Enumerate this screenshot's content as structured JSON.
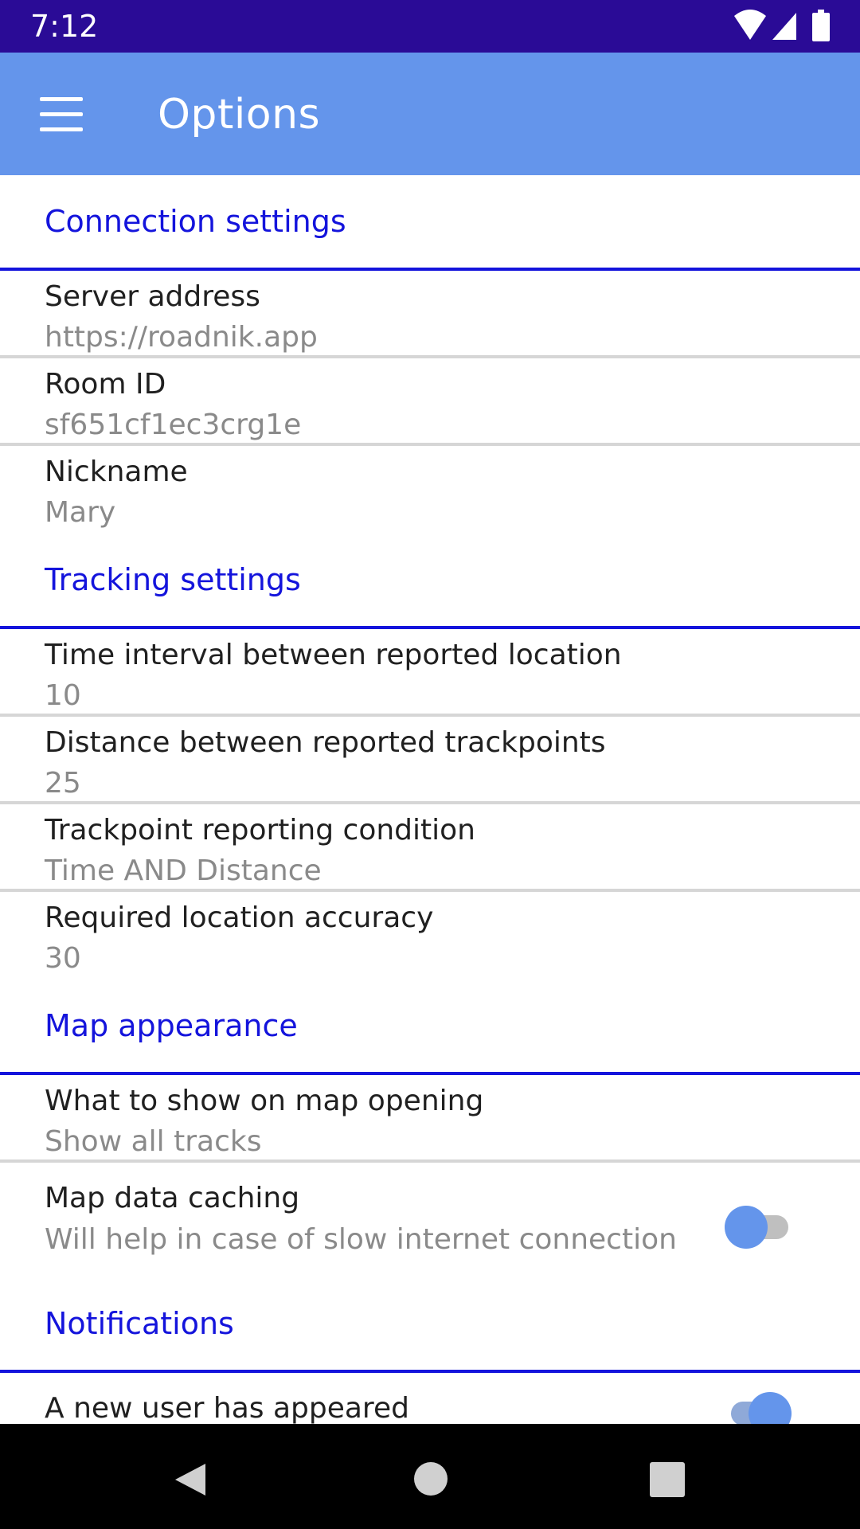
{
  "status_bar": {
    "time": "7:12",
    "icons": [
      "wifi-icon",
      "signal-icon",
      "battery-icon"
    ]
  },
  "app_bar": {
    "title": "Options",
    "menu_icon": "hamburger-menu-icon"
  },
  "sections": {
    "connection": {
      "header": "Connection settings",
      "server_address": {
        "title": "Server address",
        "summary": "https://roadnik.app"
      },
      "room_id": {
        "title": "Room ID",
        "summary": "sf651cf1ec3crg1e"
      },
      "nickname": {
        "title": "Nickname",
        "summary": "Mary"
      }
    },
    "tracking": {
      "header": "Tracking settings",
      "time_interval": {
        "title": "Time interval between reported location",
        "summary": "10"
      },
      "distance": {
        "title": "Distance between reported trackpoints",
        "summary": "25"
      },
      "condition": {
        "title": "Trackpoint reporting condition",
        "summary": "Time AND Distance"
      },
      "accuracy": {
        "title": "Required location accuracy",
        "summary": "30"
      }
    },
    "map": {
      "header": "Map appearance",
      "map_opening": {
        "title": "What to show on map opening",
        "summary": "Show all tracks"
      },
      "caching": {
        "title": "Map data caching",
        "summary": "Will help in case of slow internet connection",
        "enabled": false
      }
    },
    "notifications": {
      "header": "Notifications",
      "new_user": {
        "title": "A new user has appeared",
        "enabled": true
      }
    }
  },
  "nav_bar": {
    "icons": [
      "back-icon",
      "home-icon",
      "recents-icon"
    ]
  },
  "colors": {
    "status_bar": "#2a0b96",
    "app_bar": "#6495eb",
    "accent": "#1414dc"
  }
}
